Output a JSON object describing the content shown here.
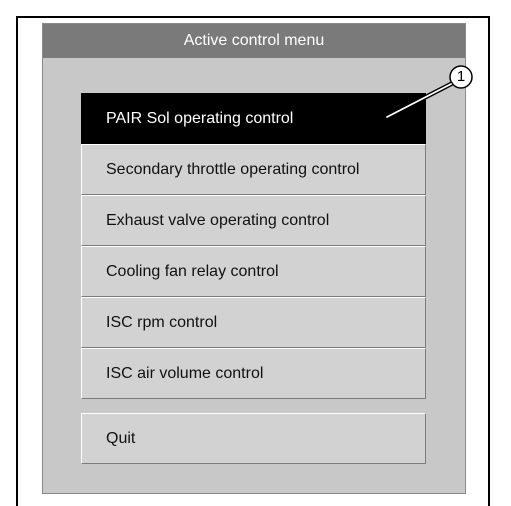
{
  "window": {
    "title": "Active control menu"
  },
  "menu": {
    "items": [
      {
        "label": "PAIR Sol operating control"
      },
      {
        "label": "Secondary throttle operating control"
      },
      {
        "label": "Exhaust valve operating control"
      },
      {
        "label": "Cooling fan relay control"
      },
      {
        "label": "ISC rpm control"
      },
      {
        "label": "ISC air volume control"
      }
    ],
    "selected_index": 0,
    "quit_label": "Quit"
  },
  "callout": {
    "number": "1"
  },
  "colors": {
    "title_bar": "#7a7a7a",
    "panel": "#c8c8c8",
    "button": "#d2d2d2",
    "selected": "#000000"
  }
}
